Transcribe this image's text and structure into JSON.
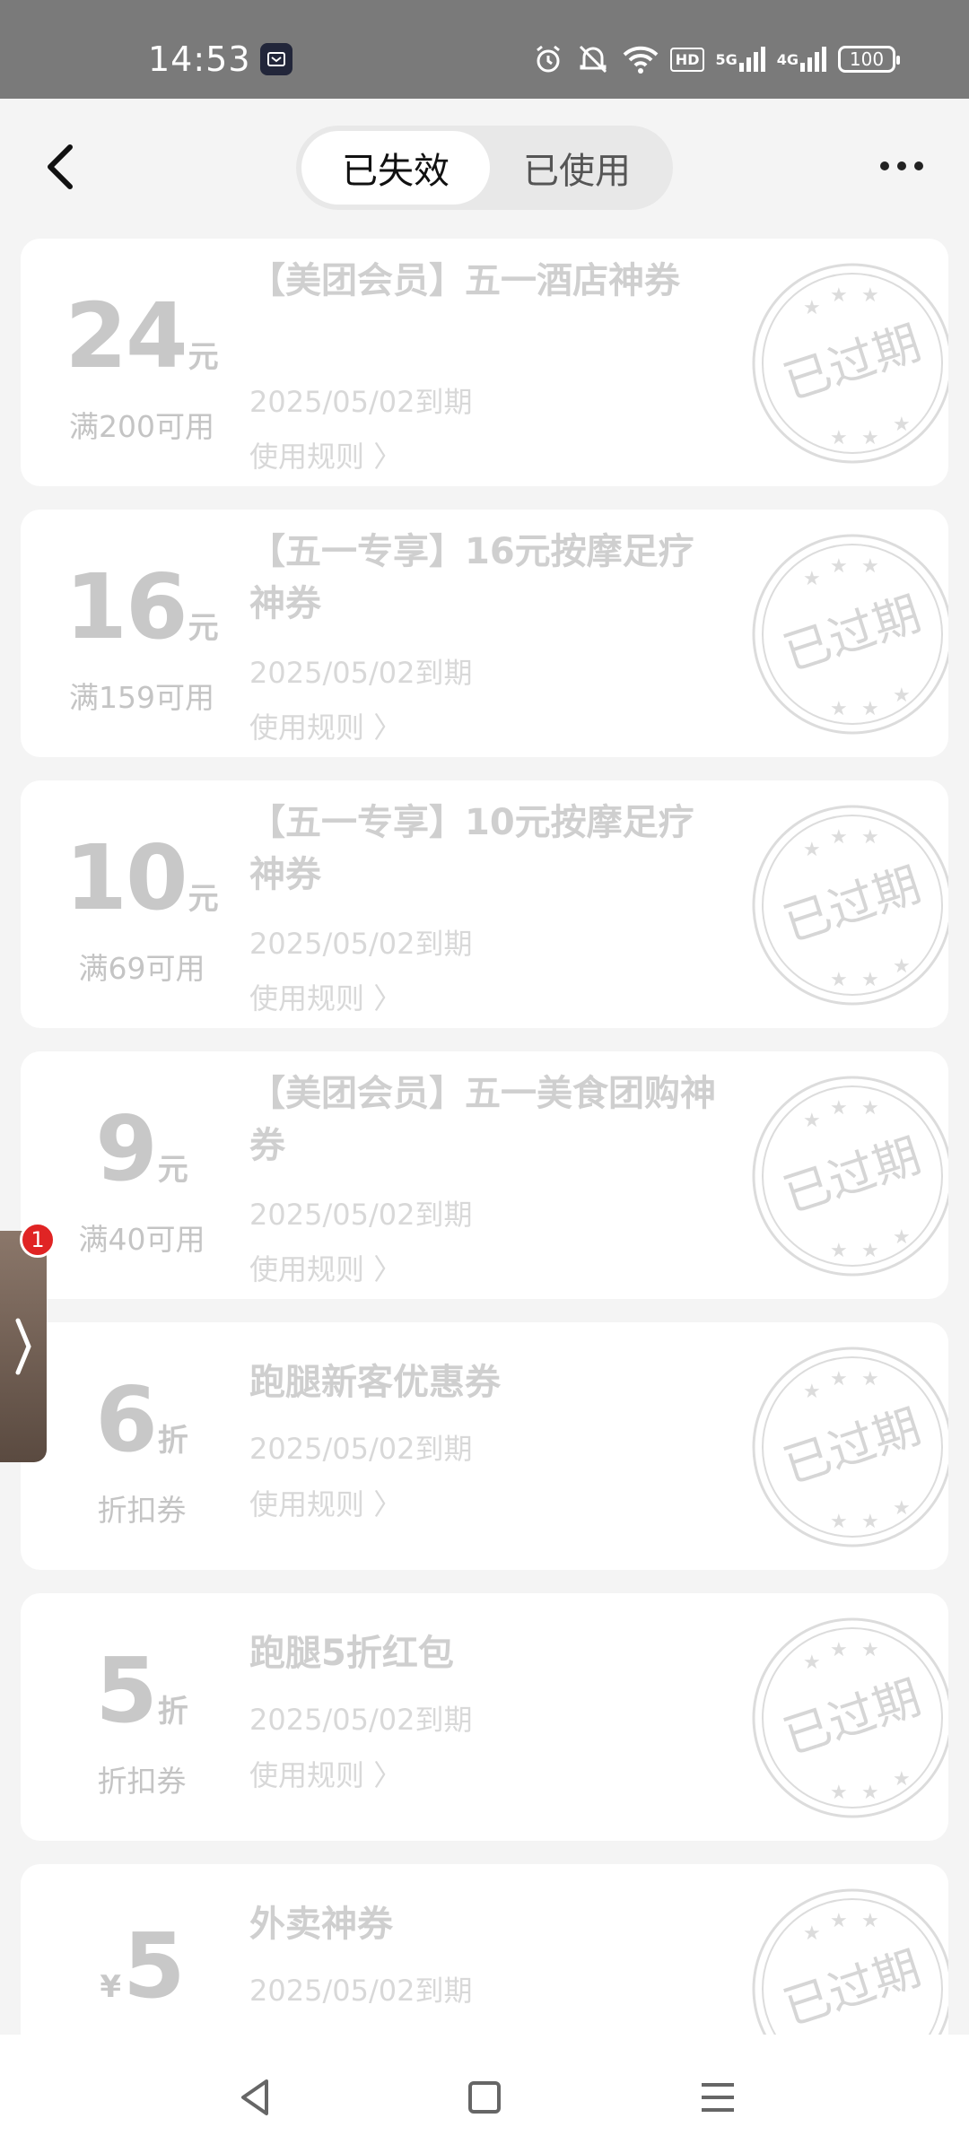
{
  "status": {
    "time": "14:53",
    "hd_label": "HD",
    "net1": "5G",
    "net2": "4G",
    "battery": "100"
  },
  "header": {
    "tabs": [
      {
        "label": "已失效",
        "active": true
      },
      {
        "label": "已使用",
        "active": false
      }
    ]
  },
  "coupons": [
    {
      "value": "24",
      "unit": "元",
      "condition": "满200可用",
      "title": "【美团会员】五一酒店神券",
      "expiry": "2025/05/02到期",
      "rule": "使用规则",
      "stamp": "已过期"
    },
    {
      "value": "16",
      "unit": "元",
      "condition": "满159可用",
      "title": "【五一专享】16元按摩足疗神券",
      "expiry": "2025/05/02到期",
      "rule": "使用规则",
      "stamp": "已过期"
    },
    {
      "value": "10",
      "unit": "元",
      "condition": "满69可用",
      "title": "【五一专享】10元按摩足疗神券",
      "expiry": "2025/05/02到期",
      "rule": "使用规则",
      "stamp": "已过期"
    },
    {
      "value": "9",
      "unit": "元",
      "condition": "满40可用",
      "title": "【美团会员】五一美食团购神券",
      "expiry": "2025/05/02到期",
      "rule": "使用规则",
      "stamp": "已过期"
    },
    {
      "value": "6",
      "unit": "折",
      "condition": "折扣券",
      "title": "跑腿新客优惠券",
      "expiry": "2025/05/02到期",
      "rule": "使用规则",
      "stamp": "已过期"
    },
    {
      "value": "5",
      "unit": "折",
      "condition": "折扣券",
      "title": "跑腿5折红包",
      "expiry": "2025/05/02到期",
      "rule": "使用规则",
      "stamp": "已过期"
    },
    {
      "value": "5",
      "prefix": "¥",
      "condition": "",
      "title": "外卖神券",
      "expiry": "2025/05/02到期",
      "rule": "",
      "stamp": "已过期"
    }
  ],
  "side_tab": {
    "badge": "1"
  },
  "colors": {
    "status_bar": "#7a7a7a",
    "background": "#f4f4f4",
    "expired_text": "#cfcfcf",
    "badge": "#e02424"
  }
}
